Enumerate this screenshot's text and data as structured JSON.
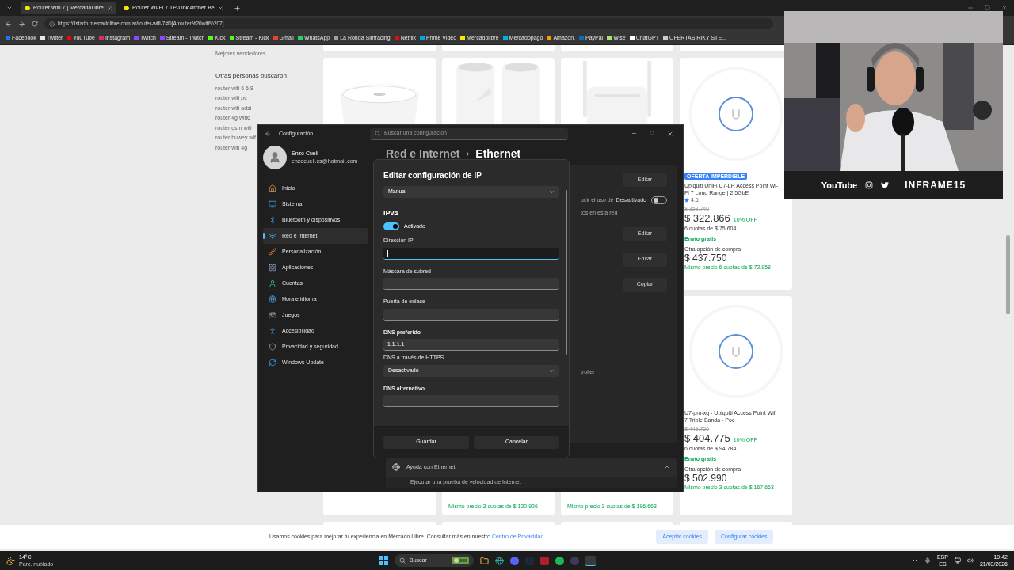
{
  "browser": {
    "tabs": [
      {
        "label": "Router Wifi 7 | MercadoLibre",
        "selected": true
      },
      {
        "label": "Router Wi-Fi 7 TP-Link Archer Be",
        "selected": false
      }
    ],
    "url": "https://listado.mercadolibre.com.ar/router-wifi-7#D[A:router%20wifi%207]",
    "bookmarks": [
      {
        "label": "Facebook",
        "color": "#1877f2"
      },
      {
        "label": "Twitter",
        "color": "#e7e7e7"
      },
      {
        "label": "YouTube",
        "color": "#ff0000"
      },
      {
        "label": "Instagram",
        "color": "#d62976"
      },
      {
        "label": "Twitch",
        "color": "#9146ff"
      },
      {
        "label": "Stream - Twitch",
        "color": "#9146ff"
      },
      {
        "label": "Kick",
        "color": "#53fc18"
      },
      {
        "label": "Stream - Kick",
        "color": "#53fc18"
      },
      {
        "label": "Gmail",
        "color": "#ea4335"
      },
      {
        "label": "WhatsApp",
        "color": "#25d366"
      },
      {
        "label": "La Ronda Simracing",
        "color": "#9aa0a6"
      },
      {
        "label": "Netflix",
        "color": "#e50914"
      },
      {
        "label": "Prime Video",
        "color": "#00a8e1"
      },
      {
        "label": "Mercadolibre",
        "color": "#ffe600"
      },
      {
        "label": "Mercadopago",
        "color": "#00b1ea"
      },
      {
        "label": "Amazon.",
        "color": "#ff9900"
      },
      {
        "label": "PayPal",
        "color": "#0070ba"
      },
      {
        "label": "Wise",
        "color": "#9fe870"
      },
      {
        "label": "ChatGPT",
        "color": "#ffffff"
      },
      {
        "label": "OFERTAS RIKY STE...",
        "color": "#cccccc"
      }
    ]
  },
  "sidebar": {
    "top": "Mejores vendedores",
    "heading": "Otras personas buscaron",
    "links": [
      "router wifi 6 5.8",
      "router wifi pc",
      "router wifi adsl",
      "router 4g wifi6",
      "router gsm wifi",
      "router huwey wif",
      "router wifi 4g"
    ]
  },
  "grid": {
    "columns": [
      {
        "cards": [
          {
            "kind": "covered"
          }
        ]
      },
      {
        "cards": [
          {
            "kind": "covered",
            "footer": "Mismo precio 3 cuotas de $ 120.926"
          }
        ]
      },
      {
        "cards": [
          {
            "kind": "covered",
            "footer": "Mismo precio 3 cuotas de $ 196.663"
          }
        ]
      },
      {
        "cards": [
          {
            "kind": "full",
            "badge": "OFERTA IMPERDIBLE",
            "title": "Ubiquiti UniFi U7-LR Access Point Wi-Fi 7 Long Range | 2.5GbE",
            "rating": "4.6",
            "old_price": "$ 358.740",
            "price": "$ 322.866",
            "discount": "10% OFF",
            "installments": "6 cuotas de $ 75.604",
            "shipping": "Envío gratis",
            "other_label": "Otra opción de compra",
            "other_price": "$ 437.750",
            "other_installments": "Mismo precio 6 cuotas de $ 72.958"
          },
          {
            "kind": "full",
            "title": "U7-pro-xg - Ubiquiti Access Point Wifi 7 Triple Banda - Poe",
            "old_price": "$ 449.750",
            "price": "$ 404.775",
            "discount": "10% OFF",
            "installments": "6 cuotas de $ 94.784",
            "shipping": "Envío gratis",
            "other_label": "Otra opción de compra",
            "other_price": "$ 502.990",
            "other_installments": "Mismo precio 3 cuotas de $ 167.663"
          }
        ]
      }
    ]
  },
  "cookie_bar": {
    "text": "Usamos cookies para mejorar tu experiencia en Mercado Libre. Consultar más en nuestro",
    "link": "Centro de Privacidad.",
    "buttons": [
      "Aceptar cookies",
      "Configurar cookies"
    ]
  },
  "settings": {
    "title": "Configuración",
    "search_placeholder": "Buscar una configuración",
    "user": {
      "name": "Enzo Cueli",
      "email": "enzocueli.cs@hotmail.com"
    },
    "nav": [
      {
        "label": "Inicio",
        "selected": false
      },
      {
        "label": "Sistema",
        "selected": false
      },
      {
        "label": "Bluetooth y dispositivos",
        "selected": false
      },
      {
        "label": "Red e Internet",
        "selected": true
      },
      {
        "label": "Personalización",
        "selected": false
      },
      {
        "label": "Aplicaciones",
        "selected": false
      },
      {
        "label": "Cuentas",
        "selected": false
      },
      {
        "label": "Hora e idioma",
        "selected": false
      },
      {
        "label": "Juegos",
        "selected": false
      },
      {
        "label": "Accesibilidad",
        "selected": false
      },
      {
        "label": "Privacidad y seguridad",
        "selected": false
      },
      {
        "label": "Windows Update",
        "selected": false
      }
    ],
    "breadcrumb": {
      "parent": "Red e Internet",
      "separator": "›",
      "current": "Ethernet"
    },
    "rows": [
      {
        "kind": "button",
        "label": "Editar"
      },
      {
        "kind": "toggle",
        "text": "ucir el uso de",
        "label": "Desactivado",
        "on": false
      },
      {
        "kind": "text",
        "text": "tos en esta red"
      },
      {
        "kind": "button",
        "label": "Editar"
      },
      {
        "kind": "button",
        "label": "Editar"
      },
      {
        "kind": "button",
        "label": "Copiar"
      },
      {
        "kind": "text",
        "text": "troller"
      }
    ],
    "help": {
      "title": "Ayuda con Ethernet",
      "expanded": true,
      "link": "Ejecutar una prueba de velocidad de Internet"
    }
  },
  "dialog": {
    "title": "Editar configuración de IP",
    "mode": "Manual",
    "section": "IPv4",
    "toggle": {
      "label": "Activado",
      "on": true
    },
    "fields": [
      {
        "kind": "text",
        "label": "Dirección IP",
        "strong": false,
        "focused": true
      },
      {
        "kind": "text",
        "label": "Máscara de subred",
        "strong": false,
        "focused": false
      },
      {
        "kind": "text",
        "label": "Puerta de enlace",
        "strong": false,
        "focused": false
      },
      {
        "kind": "text",
        "label": "DNS preferido",
        "strong": true,
        "value": "1.1.1.1",
        "focused": false
      },
      {
        "kind": "select",
        "label": "DNS a través de HTTPS",
        "strong": false,
        "value": "Desactivado"
      },
      {
        "kind": "text",
        "label": "DNS alternativo",
        "strong": true,
        "focused": false
      }
    ],
    "buttons": [
      "Guardar",
      "Cancelar"
    ]
  },
  "webcam": {
    "kind": "picture",
    "platform": "YouTube",
    "channel": "INFRAME15"
  },
  "taskbar": {
    "temperature": "14°C",
    "weather": "Parc. nublado",
    "search": "Buscar",
    "language": "ESP",
    "region": "ES",
    "time": "19:42",
    "date": "21/03/2026"
  }
}
